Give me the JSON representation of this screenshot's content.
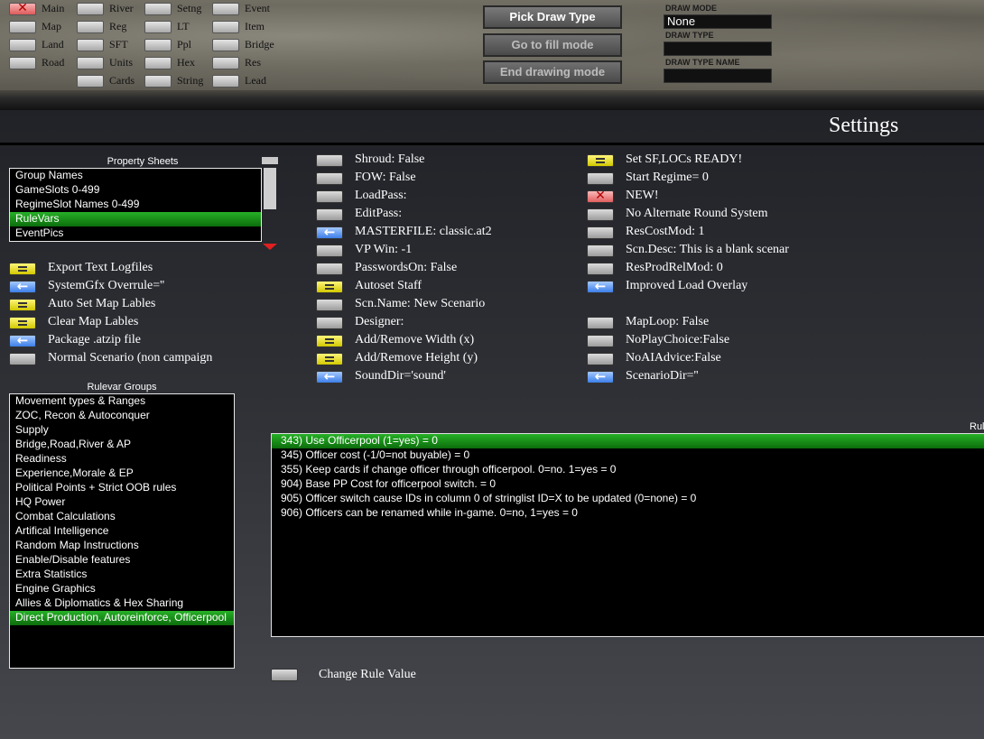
{
  "toolbar": {
    "toggles": [
      {
        "label": "Main",
        "style": "red"
      },
      {
        "label": "Map",
        "style": "gray"
      },
      {
        "label": "Land",
        "style": "gray"
      },
      {
        "label": "Road",
        "style": "gray"
      },
      {
        "label": "River",
        "style": "gray"
      },
      {
        "label": "Reg",
        "style": "gray"
      },
      {
        "label": "SFT",
        "style": "gray"
      },
      {
        "label": "Units",
        "style": "gray"
      },
      {
        "label": "Cards",
        "style": "gray"
      },
      {
        "label": "Setng",
        "style": "gray"
      },
      {
        "label": "LT",
        "style": "gray"
      },
      {
        "label": "Ppl",
        "style": "gray"
      },
      {
        "label": "Hex",
        "style": "gray"
      },
      {
        "label": "String",
        "style": "gray"
      },
      {
        "label": "Event",
        "style": "gray"
      },
      {
        "label": "Item",
        "style": "gray"
      },
      {
        "label": "Bridge",
        "style": "gray"
      },
      {
        "label": "Res",
        "style": "gray"
      },
      {
        "label": "Lead",
        "style": "gray"
      }
    ],
    "pick_draw_type": "Pick Draw Type",
    "go_to_fill_mode": "Go to fill mode",
    "end_drawing_mode": "End drawing mode",
    "draw_mode_label": "DRAW MODE",
    "draw_mode_value": "None",
    "draw_type_label": "DRAW TYPE",
    "draw_type_value": "",
    "draw_type_name_label": "DRAW TYPE NAME",
    "draw_type_name_value": ""
  },
  "page_title": "Settings",
  "property_sheets": {
    "caption": "Property Sheets",
    "items": [
      "Group Names",
      "GameSlots 0-499",
      "RegimeSlot Names 0-499",
      "RuleVars",
      "EventPics"
    ],
    "selected_index": 3
  },
  "left_actions": [
    {
      "label": "Export Text Logfiles",
      "style": "yellow"
    },
    {
      "label": "SystemGfx Overrule=''",
      "style": "blue"
    },
    {
      "label": "Auto Set Map Lables",
      "style": "yellow"
    },
    {
      "label": "Clear Map Lables",
      "style": "yellow"
    },
    {
      "label": "Package .atzip file",
      "style": "blue"
    },
    {
      "label": "Normal Scenario (non campaign",
      "style": "gray"
    }
  ],
  "rulevar_groups": {
    "caption": "Rulevar Groups",
    "items": [
      "Movement types & Ranges",
      "ZOC, Recon & Autoconquer",
      "Supply",
      "Bridge,Road,River & AP",
      "Readiness",
      "Experience,Morale & EP",
      "Political Points + Strict OOB rules",
      "HQ Power",
      "Combat Calculations",
      "Artifical Intelligence",
      "Random Map Instructions",
      "Enable/Disable features",
      "Extra Statistics",
      "Engine Graphics",
      "Allies & Diplomatics & Hex Sharing",
      "Direct Production, Autoreinforce, Officerpool"
    ],
    "selected_index": 15
  },
  "middle_options": [
    {
      "label": "Shroud: False",
      "style": "gray"
    },
    {
      "label": "FOW: False",
      "style": "gray"
    },
    {
      "label": "LoadPass:",
      "style": "gray"
    },
    {
      "label": "EditPass:",
      "style": "gray"
    },
    {
      "label": "MASTERFILE: classic.at2",
      "style": "blue"
    },
    {
      "label": "VP Win: -1",
      "style": "gray"
    },
    {
      "label": "PasswordsOn: False",
      "style": "gray"
    },
    {
      "label": "Autoset Staff",
      "style": "yellow"
    },
    {
      "label": "Scn.Name: New Scenario",
      "style": "gray"
    },
    {
      "label": "Designer:",
      "style": "gray"
    },
    {
      "label": "Add/Remove Width (x)",
      "style": "yellow"
    },
    {
      "label": "Add/Remove Height (y)",
      "style": "yellow"
    },
    {
      "label": "SoundDir='sound'",
      "style": "blue"
    }
  ],
  "right_options": [
    {
      "label": "Set SF,LOCs READY!",
      "style": "yellow"
    },
    {
      "label": "Start Regime= 0",
      "style": "gray"
    },
    {
      "label": "NEW!",
      "style": "red"
    },
    {
      "label": "No Alternate Round System",
      "style": "gray"
    },
    {
      "label": "ResCostMod:  1",
      "style": "gray"
    },
    {
      "label": "Scn.Desc: This is a blank scenar",
      "style": "gray"
    },
    {
      "label": "ResProdRelMod:  0",
      "style": "gray"
    },
    {
      "label": "Improved Load Overlay",
      "style": "blue"
    },
    {
      "label": "MapLoop: False",
      "style": "gray"
    },
    {
      "label": "NoPlayChoice:False",
      "style": "gray"
    },
    {
      "label": "NoAIAdvice:False",
      "style": "gray"
    },
    {
      "label": "ScenarioDir=''",
      "style": "blue"
    }
  ],
  "rules": {
    "caption": "Rul",
    "items": [
      "343) Use Officerpool (1=yes) =  0",
      "345) Officer cost (-1/0=not buyable) =  0",
      "355) Keep cards if change officer through officerpool. 0=no. 1=yes =  0",
      "904) Base PP Cost for officerpool switch.  =  0",
      "905) Officer switch cause IDs in column 0 of stringlist ID=X to be updated (0=none)  =  0",
      "906) Officers can be renamed while in-game. 0=no, 1=yes  =  0"
    ],
    "selected_index": 0
  },
  "change_rule_value": "Change Rule Value"
}
